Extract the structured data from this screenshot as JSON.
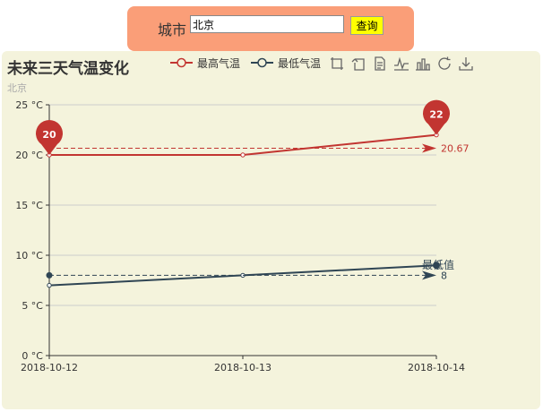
{
  "search": {
    "label": "城市",
    "value": "北京",
    "button_label": "查询"
  },
  "toolbox": {
    "icons": [
      "zoom-icon",
      "zoom-reset-icon",
      "data-view-icon",
      "line-chart-icon",
      "bar-chart-icon",
      "restore-icon",
      "save-image-icon"
    ]
  },
  "colors": {
    "panel_bg": "#f4f3dc",
    "search_bg": "#fa9e78",
    "series_high": "#c23531",
    "series_low": "#2f4554"
  },
  "chart_data": {
    "type": "line",
    "title": "未来三天气温变化",
    "subtitle": "北京",
    "categories": [
      "2018-10-12",
      "2018-10-13",
      "2018-10-14"
    ],
    "y_ticks": [
      "0 °C",
      "5 °C",
      "10 °C",
      "15 °C",
      "20 °C",
      "25 °C"
    ],
    "ylim": [
      0,
      25
    ],
    "legend_position": "top",
    "grid": true,
    "series": [
      {
        "name": "最高气温",
        "values": [
          20,
          20,
          22
        ],
        "color": "#c23531",
        "mark_points": [
          {
            "label": "22",
            "x": "2018-10-14",
            "y": 22
          },
          {
            "label": "20",
            "x": "2018-10-12",
            "y": 20
          }
        ],
        "mark_line": {
          "value": 20.67,
          "label": "20.67"
        }
      },
      {
        "name": "最低气温",
        "values": [
          7,
          8,
          9
        ],
        "color": "#2f4554",
        "mark_points": [
          {
            "label": "最低值",
            "x": "2018-10-14",
            "y": 9
          }
        ],
        "mark_line": {
          "value": 8,
          "label": "8"
        }
      }
    ]
  }
}
